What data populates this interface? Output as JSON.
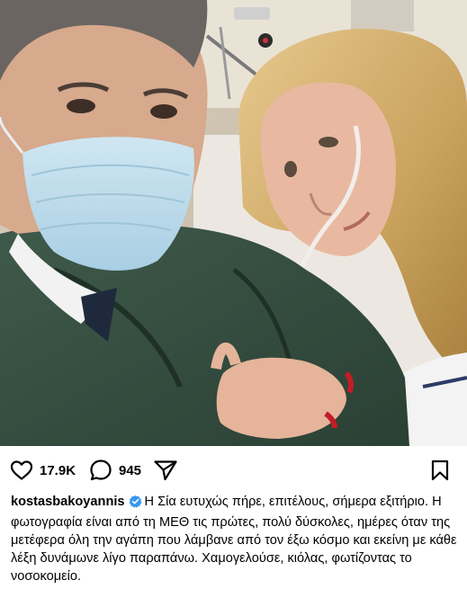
{
  "post": {
    "image_alt": "Selfie in hospital room",
    "likes": "17.9K",
    "comments": "945",
    "username": "kostasbakoyannis",
    "verified": true,
    "caption": "Η Σία ευτυχώς πήρε, επιτέλους, σήμερα εξιτήριο. Η φωτογραφία είναι από τη ΜΕΘ τις πρώτες, πολύ δύσκολες, ημέρες όταν της μετέφερα όλη την αγάπη που λάμβανε από τον έξω κόσμο και εκείνη με κάθε λέξη δυνάμωνε λίγο παραπάνω. Χαμογελούσε, κιόλας, φωτίζοντας το νοσοκομείο."
  },
  "icons": {
    "like": "heart-outline-icon",
    "comment": "comment-bubble-icon",
    "share": "paper-plane-icon",
    "save": "bookmark-icon",
    "verified": "verified-badge-icon"
  },
  "colors": {
    "verified": "#3897f0",
    "text": "#000000"
  }
}
